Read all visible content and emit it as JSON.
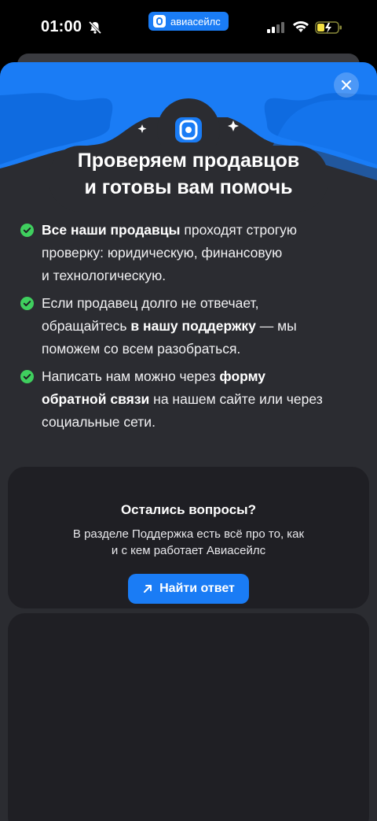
{
  "status_bar": {
    "time": "01:00",
    "app_name": "авиасейлс"
  },
  "modal": {
    "title_line1": "Проверяем продавцов",
    "title_line2": "и готовы вам помочь",
    "bullets": [
      {
        "parts": [
          {
            "t": "Все наши продавцы",
            "b": true
          },
          {
            "t": " проходят строгую",
            "b": false
          },
          {
            "br": true
          },
          {
            "t": "проверку: юридическую, финансовую",
            "b": false
          },
          {
            "br": true
          },
          {
            "t": "и технологическую.",
            "b": false
          }
        ]
      },
      {
        "parts": [
          {
            "t": "Если продавец долго не отвечает,",
            "b": false
          },
          {
            "br": true
          },
          {
            "t": "обращайтесь ",
            "b": false
          },
          {
            "t": "в нашу поддержку",
            "b": true
          },
          {
            "t": " — мы",
            "b": false
          },
          {
            "br": true
          },
          {
            "t": "поможем со всем разобраться.",
            "b": false
          }
        ]
      },
      {
        "parts": [
          {
            "t": "Написать нам можно через ",
            "b": false
          },
          {
            "t": "форму",
            "b": true
          },
          {
            "br": true
          },
          {
            "t": "обратной связи",
            "b": true
          },
          {
            "t": " на нашем сайте или через",
            "b": false
          },
          {
            "br": true
          },
          {
            "t": "социальные сети.",
            "b": false
          }
        ]
      }
    ],
    "help": {
      "title": "Остались вопросы?",
      "text_line1": "В разделе Поддержка есть всё про то, как",
      "text_line2": "и с кем работает Авиасейлс",
      "button_label": "Найти ответ"
    }
  },
  "colors": {
    "accent": "#1a7cf5",
    "sheet": "#2b2c31",
    "card": "#1f1f24",
    "check": "#3fcf5e"
  }
}
